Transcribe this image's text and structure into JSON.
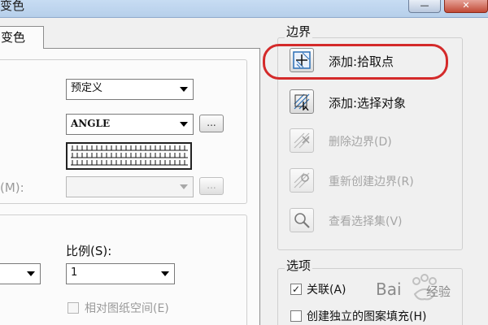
{
  "window": {
    "title": "变色",
    "close_glyph": "✕",
    "min_glyph": "—"
  },
  "tab": {
    "label": "变色"
  },
  "left": {
    "pattern_type": {
      "value": "预定义"
    },
    "pattern_name": {
      "value": "ANGLE",
      "button": "..."
    },
    "custom_pattern": {
      "label": "(M):",
      "value": "",
      "button": "..."
    },
    "scale": {
      "label": "比例(S):",
      "value": "1"
    },
    "relative_paper": {
      "label": "相对图纸空间(E)",
      "checked": false
    }
  },
  "boundary": {
    "title": "边界",
    "actions": [
      {
        "label": "添加:拾取点",
        "enabled": true,
        "icon": "pick-points-icon"
      },
      {
        "label": "添加:选择对象",
        "enabled": true,
        "icon": "select-objects-icon"
      },
      {
        "label": "删除边界(D)",
        "enabled": false,
        "icon": "remove-boundary-icon"
      },
      {
        "label": "重新创建边界(R)",
        "enabled": false,
        "icon": "recreate-boundary-icon"
      },
      {
        "label": "查看选择集(V)",
        "enabled": false,
        "icon": "view-selection-icon"
      }
    ]
  },
  "options": {
    "title": "选项",
    "associative": {
      "label": "关联(A)",
      "checked": true
    },
    "separate": {
      "label": "创建独立的图案填充(H)",
      "checked": false
    }
  },
  "watermark": {
    "text": "Bai",
    "text2": "经验"
  },
  "colors": {
    "highlight": "#d42a2a",
    "accent": "#2b6fb6"
  }
}
